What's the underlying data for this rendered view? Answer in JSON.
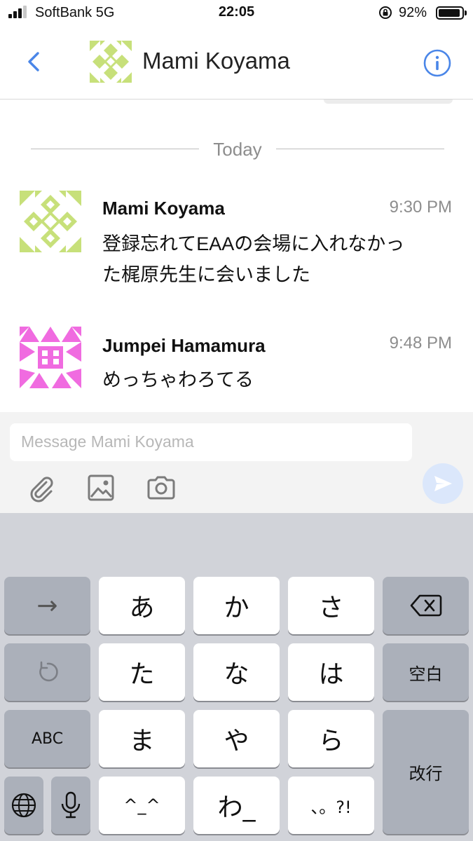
{
  "status_bar": {
    "carrier": "SoftBank   5G",
    "time": "22:05",
    "battery_percent": "92%",
    "battery_level": 0.92,
    "signal_bars": 3
  },
  "nav": {
    "back_icon": "chevron-left-icon",
    "title": "Mami Koyama",
    "info_icon": "info-icon",
    "accent_color": "#4a86e8"
  },
  "divider": {
    "label": "Today"
  },
  "messages": [
    {
      "sender": "Mami Koyama",
      "time": "9:30 PM",
      "lines": [
        "登録忘れてEAAの会場に入れなかっ",
        "た梶原先生に会いました"
      ],
      "avatar_color": "#c7e07a"
    },
    {
      "sender": "Jumpei Hamamura",
      "time": "9:48 PM",
      "lines": [
        "めっちゃわろてる"
      ],
      "avatar_color": "#f06be0"
    }
  ],
  "composer": {
    "placeholder": "Message Mami Koyama",
    "tools": [
      "paperclip-icon",
      "image-icon",
      "camera-icon"
    ],
    "send_icon": "send-icon"
  },
  "keyboard": {
    "rows": [
      [
        "→",
        "あ",
        "か",
        "さ",
        "⌫"
      ],
      [
        "↺",
        "た",
        "な",
        "は",
        "空白"
      ],
      [
        "ABC",
        "ま",
        "や",
        "ら",
        "改行"
      ],
      [
        "🌐",
        "🎤",
        "^_^",
        "わ_",
        "、。?!"
      ]
    ],
    "labels": {
      "next": "→",
      "a": "あ",
      "ka": "か",
      "sa": "さ",
      "ta": "た",
      "na": "な",
      "ha": "は",
      "space": "空白",
      "abc": "ABC",
      "ma": "ま",
      "ya": "や",
      "ra": "ら",
      "return": "改行",
      "emoticon": "^_^",
      "wa": "わ_",
      "punct": "、。?!"
    }
  }
}
